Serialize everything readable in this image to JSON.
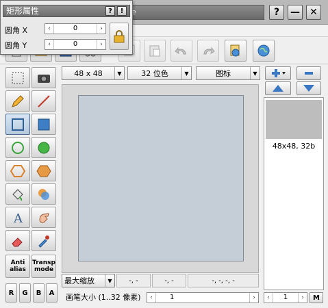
{
  "window": {
    "title_partial": "are",
    "help_label": "?",
    "minimize_label": "—",
    "close_label": "✕"
  },
  "props_panel": {
    "title": "矩形属性",
    "help_label": "?",
    "pin_label": "!",
    "radius_x_label": "圆角 X",
    "radius_x_value": "0",
    "radius_y_label": "圆角 Y",
    "radius_y_value": "0"
  },
  "toolbar": {
    "icons": [
      "new-icon",
      "open-icon",
      "save-icon",
      "cut-icon",
      "copy-icon",
      "paste-icon",
      "undo-icon",
      "redo-icon",
      "resource-icon",
      "globe-icon"
    ]
  },
  "image_options": {
    "size": "48 x 48",
    "color_depth": "32 位色",
    "type": "图标"
  },
  "tools": {
    "antialias_line1": "Anti",
    "antialias_line2": "alias",
    "transp_line1": "Transp",
    "transp_line2": "mode",
    "channels": [
      "R",
      "G",
      "B",
      "A"
    ]
  },
  "statusbar": {
    "zoom": "最大缩放",
    "field1": "-, -",
    "field2": "-, -",
    "field3": "-, -, -, -",
    "brush_label": "画笔大小 (1..32 像素)",
    "brush_value": "1"
  },
  "preview": {
    "caption": "48x48, 32b",
    "page_value": "1",
    "m_label": "M"
  }
}
